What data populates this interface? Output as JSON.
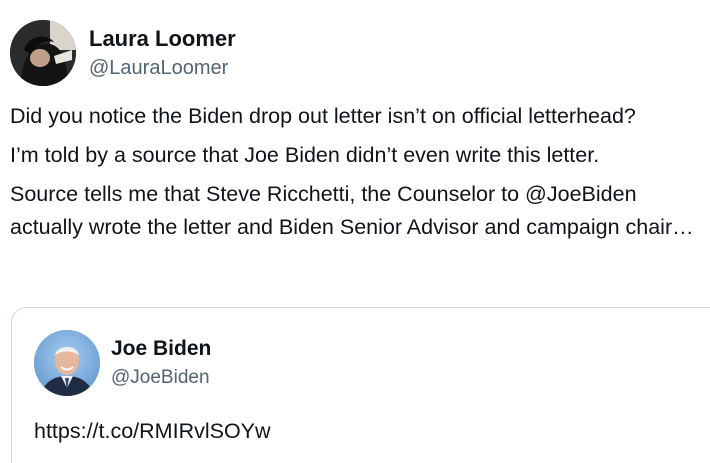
{
  "tweet": {
    "author": {
      "display_name": "Laura Loomer",
      "handle": "@LauraLoomer"
    },
    "paragraphs": [
      "Did you notice the Biden drop out letter isn’t on official letterhead?",
      "I’m told by a source that Joe Biden didn’t even write this letter.",
      "Source tells me that Steve Ricchetti, the Counselor to @JoeBiden actually wrote the letter and Biden Senior Advisor and campaign chair…"
    ]
  },
  "quoted_tweet": {
    "author": {
      "display_name": "Joe Biden",
      "handle": "@JoeBiden"
    },
    "text": "https://t.co/RMIRvlSOYw"
  }
}
